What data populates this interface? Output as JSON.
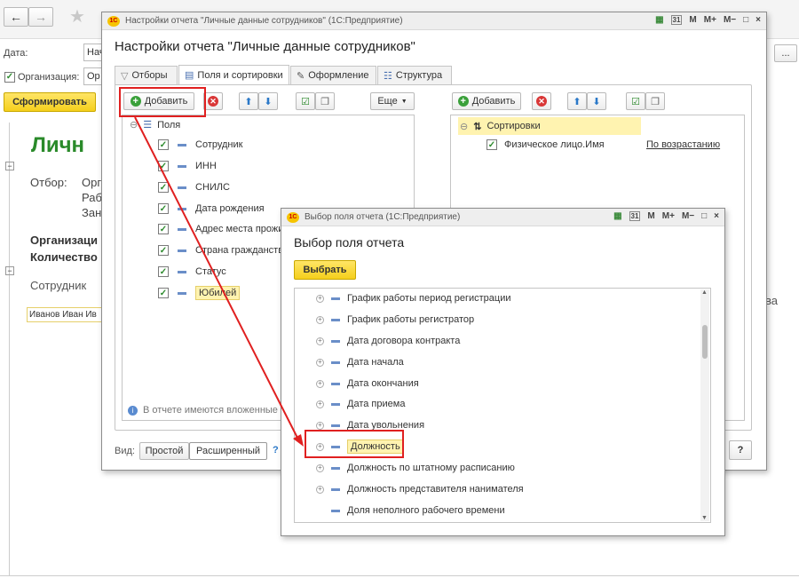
{
  "background": {
    "date_label": "Дата:",
    "date_value": "Нач",
    "org_label": "Организация:",
    "org_value": "Ор",
    "form_button": "Сформировать",
    "report_title": "Личн",
    "filter_label": "Отбор:",
    "filter_lines": [
      "Орг",
      "Раб",
      "Зан"
    ],
    "org_line": "Организаци",
    "count_line": "Количество",
    "col_employee": "Сотрудник",
    "row_employee": "Иванов Иван Ив",
    "right_fragment": "ва",
    "ellipsis": "..."
  },
  "settings_window": {
    "titlebar": "Настройки отчета \"Личные данные сотрудников\" (1С:Предприятие)",
    "heading": "Настройки отчета \"Личные данные сотрудников\"",
    "tabs": [
      "Отборы",
      "Поля и сортировки",
      "Оформление",
      "Структура"
    ],
    "add_button": "Добавить",
    "more_button": "Еще",
    "fields_root": "Поля",
    "fields": [
      "Сотрудник",
      "ИНН",
      "СНИЛС",
      "Дата рождения",
      "Адрес места прожи",
      "Страна гражданства",
      "Статус",
      "Юбилей"
    ],
    "nested_note": "В отчете имеются вложенные по",
    "sort_add_button": "Добавить",
    "sort_root": "Сортировки",
    "sort_field": "Физическое лицо.Имя",
    "sort_order": "По возрастанию",
    "view_label": "Вид:",
    "view_simple": "Простой",
    "view_extended": "Расширенный",
    "help_small": "?",
    "help_button": "?",
    "tb_m": "M",
    "tb_mplus": "M+",
    "tb_mminus": "M−",
    "tb_close": "×",
    "tb_max": "□",
    "calendar_num": "31"
  },
  "select_window": {
    "titlebar": "Выбор поля отчета (1С:Предприятие)",
    "heading": "Выбор поля отчета",
    "select_button": "Выбрать",
    "items": [
      {
        "label": "График работы период регистрации",
        "expandable": true
      },
      {
        "label": "График работы регистратор",
        "expandable": true
      },
      {
        "label": "Дата договора контракта",
        "expandable": true
      },
      {
        "label": "Дата начала",
        "expandable": true
      },
      {
        "label": "Дата окончания",
        "expandable": true
      },
      {
        "label": "Дата приема",
        "expandable": true
      },
      {
        "label": "Дата увольнения",
        "expandable": true
      },
      {
        "label": "Должность",
        "expandable": true,
        "highlighted": true
      },
      {
        "label": "Должность по штатному расписанию",
        "expandable": true
      },
      {
        "label": "Должность представителя нанимателя",
        "expandable": true
      },
      {
        "label": "Доля неполного рабочего времени",
        "expandable": false
      }
    ]
  },
  "colors": {
    "accent_yellow": "#f5cf1c",
    "highlight_red": "#e02020",
    "title_green": "#2a8a2a"
  }
}
